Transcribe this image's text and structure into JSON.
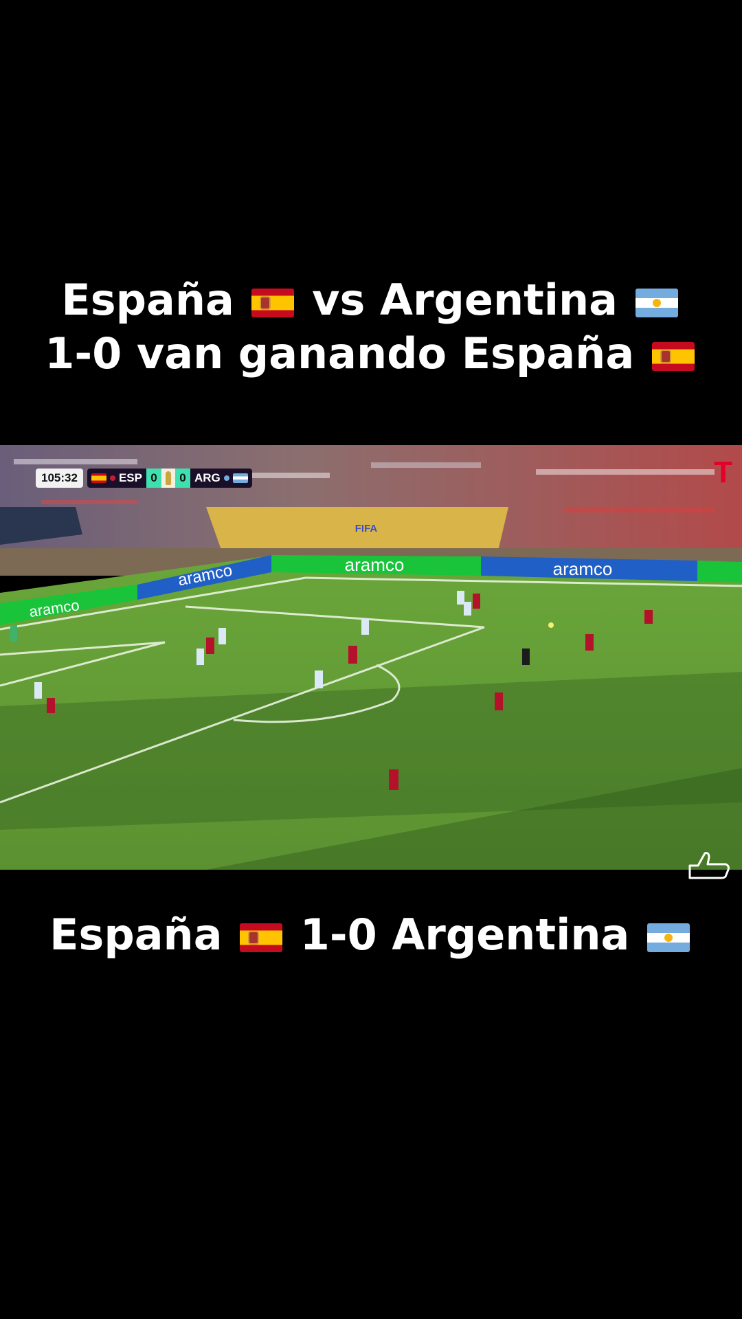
{
  "top_caption": {
    "line1": {
      "text_a": "España",
      "text_b": "vs Argentina"
    },
    "line2": {
      "text": "1-0 van ganando España"
    }
  },
  "video": {
    "scorebug": {
      "clock": "105:32",
      "home_code": "ESP",
      "home_score": "0",
      "away_score": "0",
      "away_code": "ARG"
    },
    "ads": [
      "aramco",
      "aramco",
      "aramco",
      "aramco"
    ],
    "stand_banner": "FIFA",
    "network_logo": "T",
    "colors": {
      "pitch": "#5f9a34",
      "spain": "#b3122a",
      "argentina": "#dbe8f6",
      "board": "#19c43a",
      "board_blue": "#1f5fc6"
    }
  },
  "bottom_caption": {
    "text_a": "España",
    "text_b": "1-0 Argentina"
  },
  "icons": [
    "spain-flag-icon",
    "argentina-flag-icon",
    "thumbs-up-icon"
  ]
}
